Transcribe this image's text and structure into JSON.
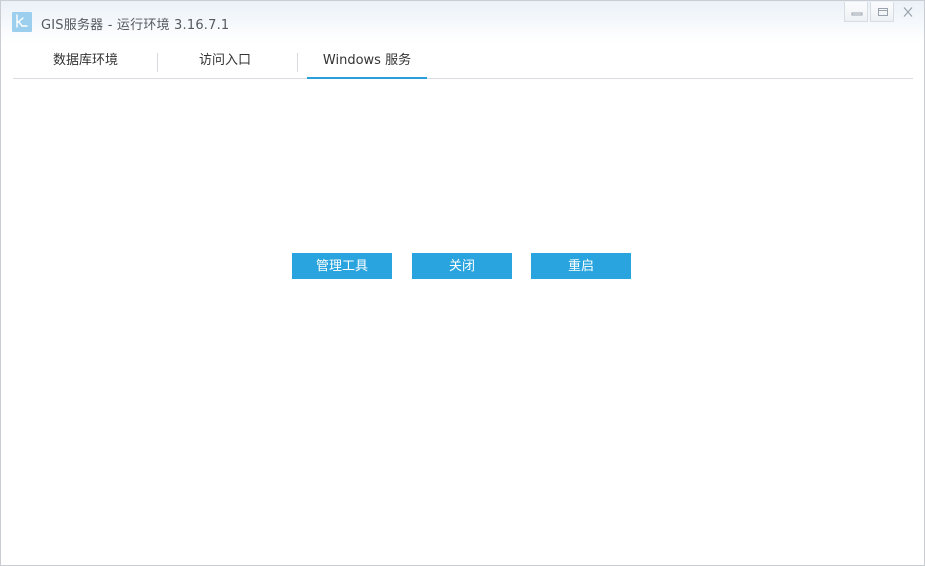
{
  "window": {
    "title": "GIS服务器 - 运行环境 3.16.7.1",
    "app_icon": "k-logo-icon",
    "controls": {
      "minimize_icon": "minimize-icon",
      "maximize_icon": "maximize-icon",
      "close_icon": "close-icon"
    }
  },
  "tabs": [
    {
      "label": "数据库环境",
      "active": false
    },
    {
      "label": "访问入口",
      "active": false
    },
    {
      "label": "Windows 服务",
      "active": true
    }
  ],
  "actions": {
    "tools_label": "管理工具",
    "close_label": "关闭",
    "restart_label": "重启"
  },
  "colors": {
    "accent": "#2aa4de",
    "tab_underline": "#2b9fd9",
    "title_text": "#555a60",
    "icon_bg": "#9ccfee"
  }
}
